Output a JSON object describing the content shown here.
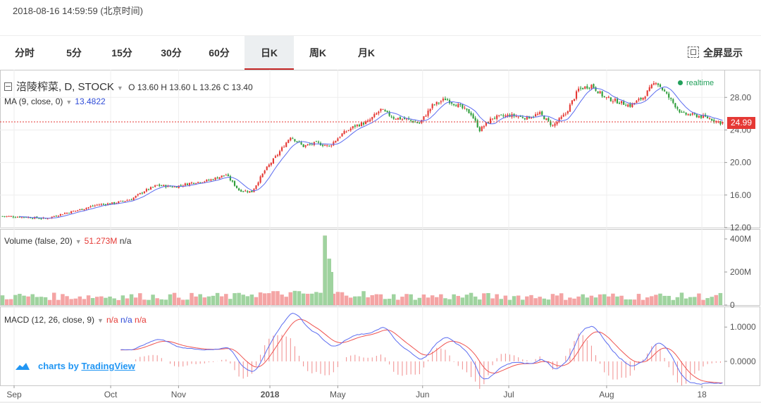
{
  "timestamp": "2018-08-16 14:59:59 (北京时间)",
  "tabs": [
    {
      "label": "分时"
    },
    {
      "label": "5分"
    },
    {
      "label": "15分"
    },
    {
      "label": "30分"
    },
    {
      "label": "60分"
    },
    {
      "label": "日K",
      "active": true
    },
    {
      "label": "周K"
    },
    {
      "label": "月K"
    }
  ],
  "fullscreen_label": "全屏显示",
  "legend": {
    "symbol": "涪陵榨菜, D, STOCK",
    "o_label": "O",
    "o": "13.60",
    "h_label": "H",
    "h": "13.60",
    "l_label": "L",
    "l": "13.26",
    "c_label": "C",
    "c": "13.40",
    "ma_label": "MA (9, close, 0)",
    "ma_value": "13.4822",
    "volume_label": "Volume (false, 20)",
    "volume_value": "51.273M",
    "volume_na": "n/a",
    "macd_label": "MACD (12, 26, close, 9)",
    "macd_na1": "n/a",
    "macd_na2": "n/a",
    "macd_na3": "n/a"
  },
  "realtime_label": "realtime",
  "last_price": "24.99",
  "branding": {
    "prefix": "charts by",
    "brand": "TradingView"
  },
  "colors": {
    "up": "#e53935",
    "down": "#2e9d3a",
    "ma": "#5b6cf0",
    "macd_line": "#5b6cf0",
    "signal_line": "#ef5350"
  },
  "chart_data": {
    "type": "candlestick",
    "x_ticks": [
      "Sep",
      "Oct",
      "Nov",
      "2018",
      "May",
      "Jun",
      "Jul",
      "Aug",
      "18"
    ],
    "price_axis": {
      "ticks": [
        "12.00",
        "16.00",
        "20.00",
        "24.00",
        "28.00"
      ],
      "ylim": [
        12,
        31.4
      ]
    },
    "volume_axis": {
      "ticks": [
        "0",
        "200M",
        "400M"
      ],
      "ylim": [
        0,
        460
      ]
    },
    "macd_axis": {
      "ticks": [
        "0.0000",
        "1.0000"
      ],
      "ylim": [
        -0.7,
        1.6
      ]
    },
    "close_anchors": [
      [
        0,
        13.4
      ],
      [
        10,
        13.3
      ],
      [
        20,
        13.1
      ],
      [
        28,
        13.7
      ],
      [
        36,
        14.2
      ],
      [
        44,
        14.8
      ],
      [
        52,
        15.0
      ],
      [
        60,
        15.5
      ],
      [
        66,
        16.5
      ],
      [
        72,
        17.2
      ],
      [
        80,
        17.0
      ],
      [
        88,
        17.5
      ],
      [
        96,
        17.8
      ],
      [
        104,
        18.5
      ],
      [
        110,
        16.6
      ],
      [
        116,
        16.4
      ],
      [
        122,
        19.0
      ],
      [
        128,
        21.0
      ],
      [
        134,
        23.2
      ],
      [
        140,
        22.0
      ],
      [
        146,
        22.4
      ],
      [
        152,
        22.0
      ],
      [
        158,
        23.5
      ],
      [
        164,
        24.5
      ],
      [
        170,
        25.0
      ],
      [
        176,
        26.5
      ],
      [
        182,
        25.5
      ],
      [
        188,
        25.3
      ],
      [
        194,
        24.8
      ],
      [
        200,
        27.0
      ],
      [
        206,
        27.8
      ],
      [
        212,
        27.0
      ],
      [
        218,
        26.0
      ],
      [
        222,
        24.0
      ],
      [
        228,
        25.5
      ],
      [
        236,
        25.8
      ],
      [
        244,
        25.5
      ],
      [
        250,
        26.0
      ],
      [
        256,
        24.5
      ],
      [
        262,
        26.0
      ],
      [
        268,
        29.0
      ],
      [
        274,
        29.5
      ],
      [
        280,
        28.0
      ],
      [
        286,
        27.5
      ],
      [
        292,
        27.0
      ],
      [
        298,
        28.0
      ],
      [
        304,
        30.0
      ],
      [
        310,
        28.0
      ],
      [
        316,
        26.0
      ],
      [
        322,
        25.8
      ],
      [
        328,
        25.5
      ],
      [
        334,
        24.9
      ]
    ],
    "ma_period": 9,
    "volume_spikes": [
      [
        150,
        420
      ],
      [
        153,
        200
      ],
      [
        152,
        280
      ],
      [
        155,
        110
      ],
      [
        329,
        140
      ]
    ],
    "last_close": 24.99
  }
}
